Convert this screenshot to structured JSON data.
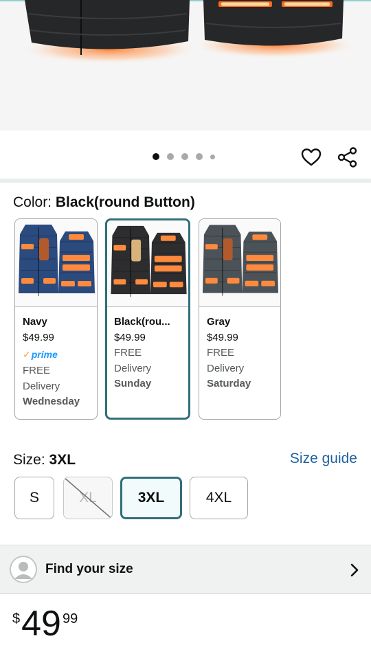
{
  "product": {
    "image_alt": "heated vest product image",
    "carousel": {
      "count": 5,
      "active_index": 0
    }
  },
  "color": {
    "label": "Color: ",
    "selected": "Black(round Button)",
    "options": [
      {
        "name": "Navy",
        "price": "$49.99",
        "prime": true,
        "prime_label": "prime",
        "delivery_line1": "FREE",
        "delivery_line2": "Delivery",
        "delivery_day": "Wednesday",
        "body_color": "#2b4a7e"
      },
      {
        "name": "Black(rou...",
        "price": "$49.99",
        "prime": false,
        "delivery_line1": "FREE",
        "delivery_line2": "Delivery",
        "delivery_day": "Sunday",
        "body_color": "#2d2d2f"
      },
      {
        "name": "Gray",
        "price": "$49.99",
        "prime": false,
        "delivery_line1": "FREE",
        "delivery_line2": "Delivery",
        "delivery_day": "Saturday",
        "body_color": "#4b5358"
      }
    ]
  },
  "size": {
    "label": "Size: ",
    "selected": "3XL",
    "guide_label": "Size guide",
    "options": [
      {
        "label": "S",
        "state": "available"
      },
      {
        "label": "XL",
        "state": "unavailable"
      },
      {
        "label": "3XL",
        "state": "selected"
      },
      {
        "label": "4XL",
        "state": "available"
      }
    ]
  },
  "find_size": {
    "label": "Find your size"
  },
  "price": {
    "currency": "$",
    "whole": "49",
    "fraction": "99"
  },
  "colors": {
    "accent_teal": "#2f6f7a",
    "link_blue": "#2162a1",
    "prime_blue": "#1a98ff",
    "heat_orange": "#ff8a3d"
  }
}
